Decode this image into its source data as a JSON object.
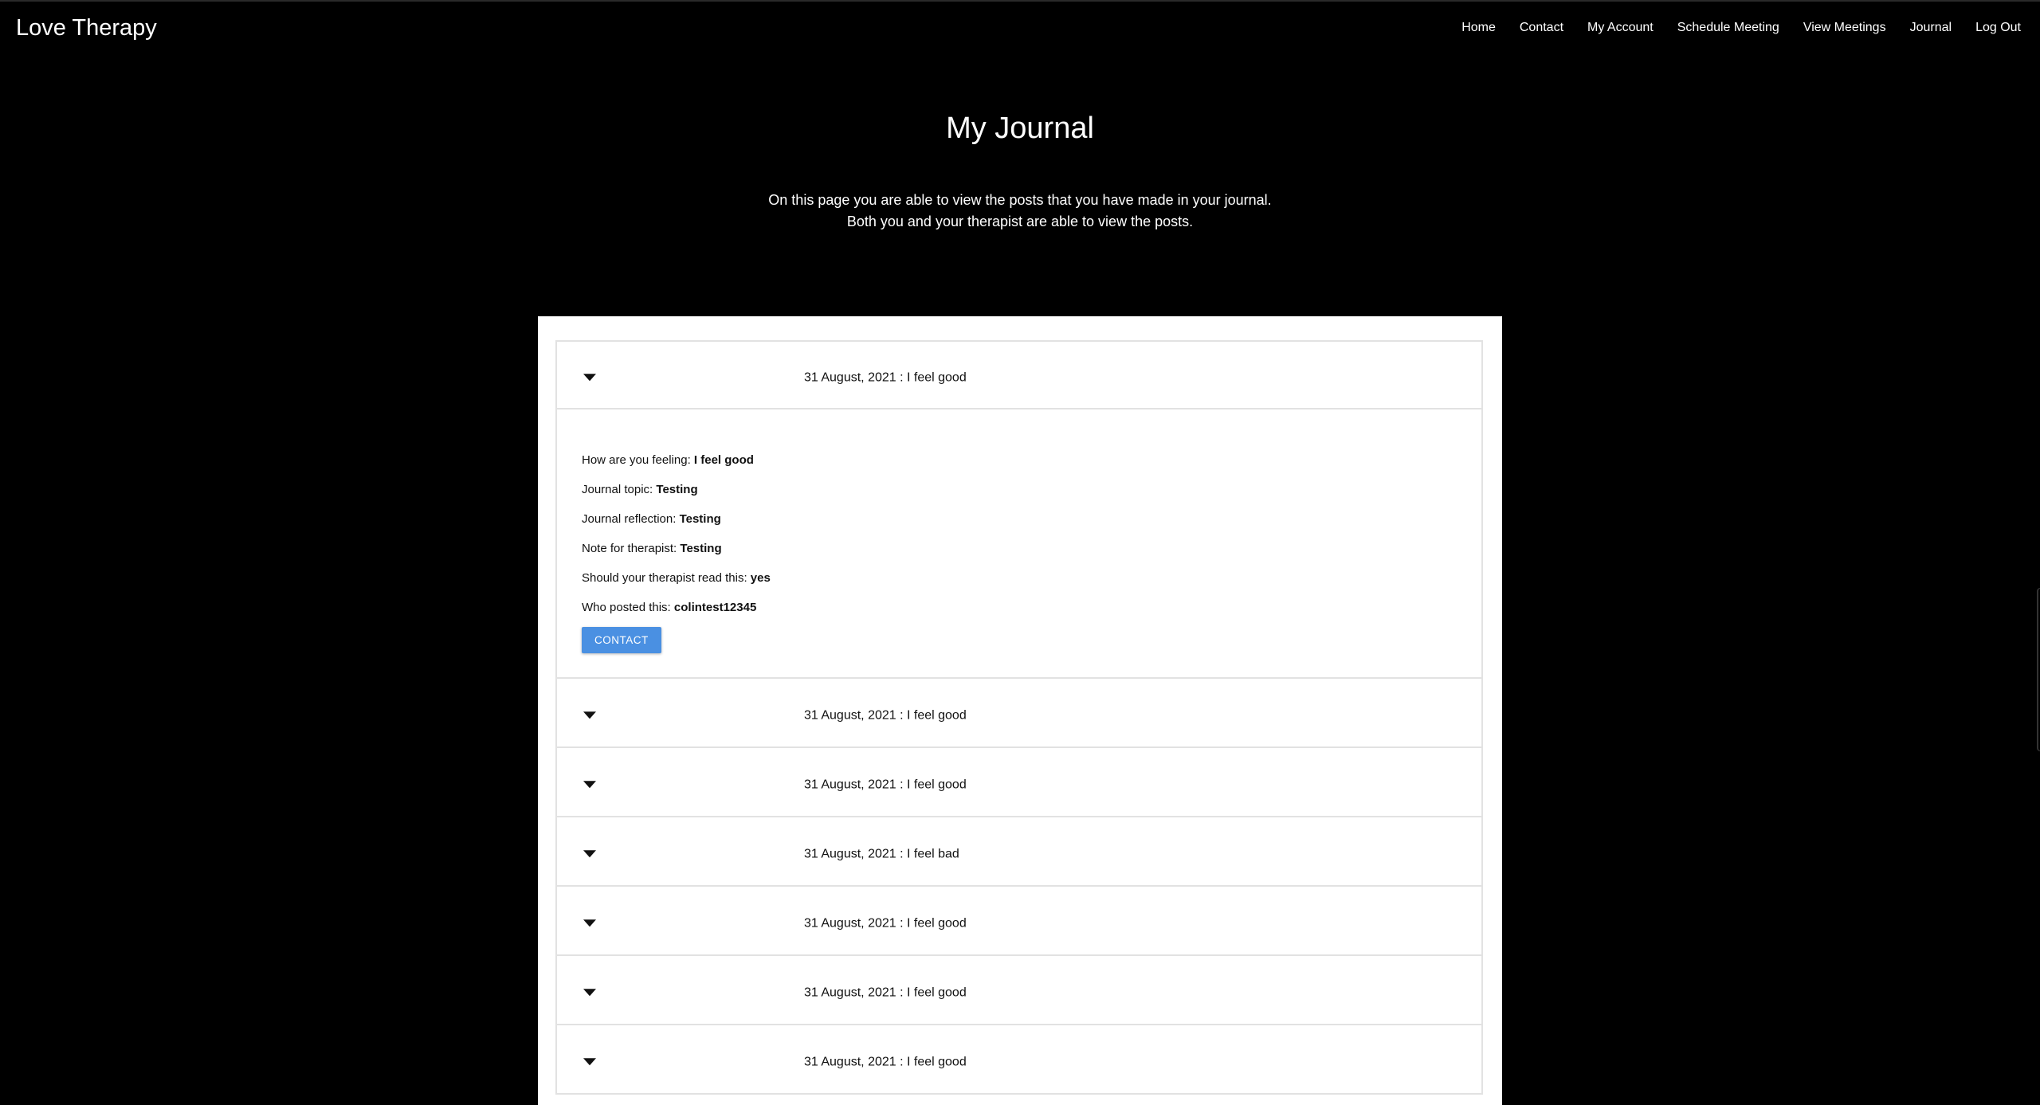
{
  "header": {
    "brand": "Love Therapy",
    "nav": [
      "Home",
      "Contact",
      "My Account",
      "Schedule Meeting",
      "View Meetings",
      "Journal",
      "Log Out"
    ]
  },
  "hero": {
    "title": "My Journal",
    "line1": "On this page you are able to view the posts that you have made in your journal.",
    "line2": "Both you and your therapist are able to view the posts."
  },
  "entries": [
    {
      "title": "31 August, 2021 : I feel good",
      "expanded": true,
      "fields": [
        {
          "label": "How are you feeling: ",
          "value": "I feel good"
        },
        {
          "label": "Journal topic: ",
          "value": "Testing"
        },
        {
          "label": "Journal reflection: ",
          "value": "Testing"
        },
        {
          "label": "Note for therapist: ",
          "value": "Testing"
        },
        {
          "label": "Should your therapist read this: ",
          "value": "yes"
        },
        {
          "label": "Who posted this: ",
          "value": "colintest12345"
        }
      ],
      "button": "CONTACT"
    },
    {
      "title": "31 August, 2021 : I feel good"
    },
    {
      "title": "31 August, 2021 : I feel good"
    },
    {
      "title": "31 August, 2021 : I feel bad"
    },
    {
      "title": "31 August, 2021 : I feel good"
    },
    {
      "title": "31 August, 2021 : I feel good"
    },
    {
      "title": "31 August, 2021 : I feel good"
    }
  ],
  "colors": {
    "background": "#000000",
    "panel": "#ffffff",
    "button": "#4a90e2"
  },
  "icons": {
    "expand": "chevron-down-icon"
  }
}
